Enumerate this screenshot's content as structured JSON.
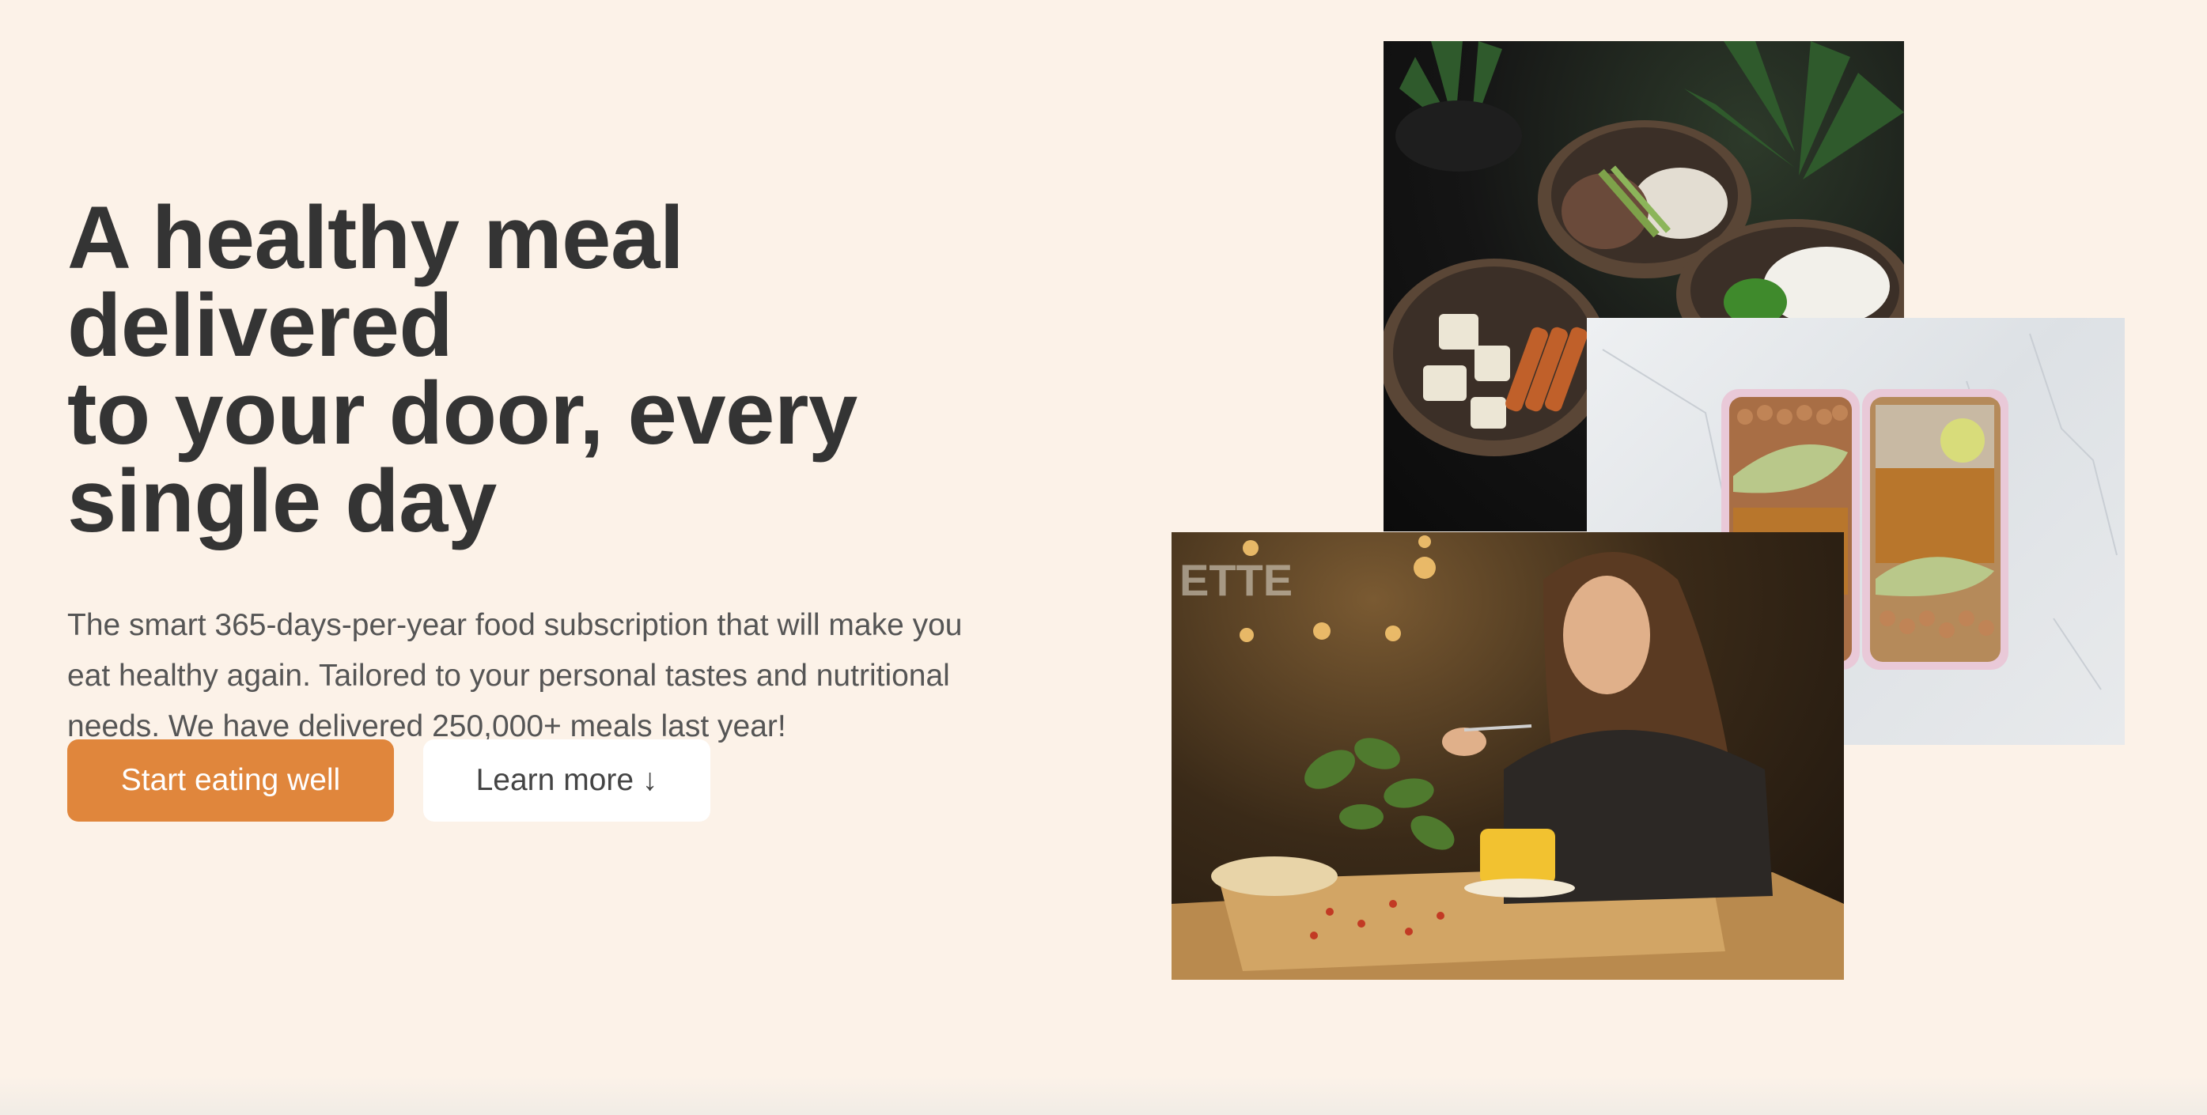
{
  "hero": {
    "title_line1": "A healthy meal delivered",
    "title_line2": "to your door, every",
    "title_line3": "single day",
    "description_line1": "The smart 365-days-per-year food subscription that will make you",
    "description_line2": "eat healthy again. Tailored to your personal tastes and nutritional",
    "description_line3": "needs. We have delivered 250,000+ meals last year!",
    "primary_cta": "Start eating well",
    "secondary_cta": "Learn more ↓"
  },
  "colors": {
    "background": "#fcf2e8",
    "heading": "#343434",
    "body_text": "#555555",
    "accent": "#e0863c",
    "button_light": "#ffffff"
  }
}
